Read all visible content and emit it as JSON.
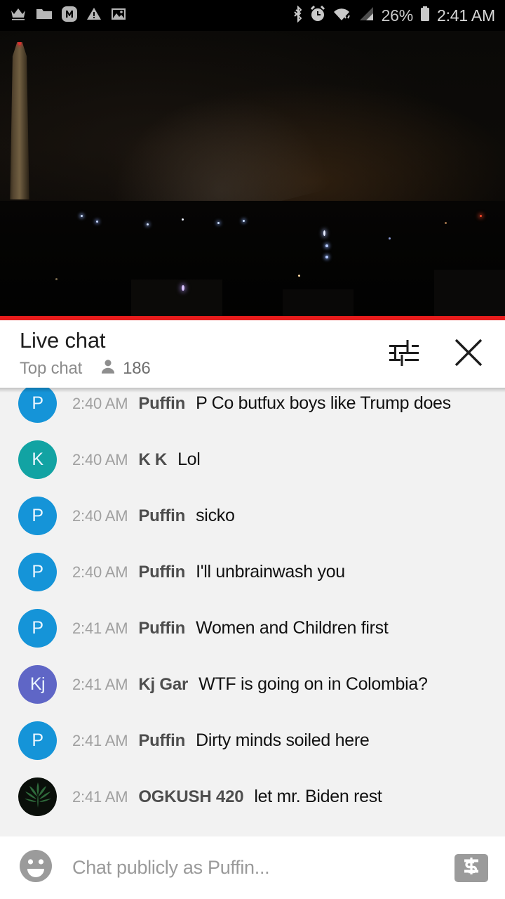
{
  "status_bar": {
    "left_icons": [
      "crown-icon",
      "folder-icon",
      "m-badge-icon",
      "warning-icon",
      "image-icon"
    ],
    "right_icons": [
      "bluetooth-icon",
      "alarm-icon",
      "wifi-icon",
      "cellular-signal-icon",
      "battery-icon"
    ],
    "battery_percent": "26%",
    "time": "2:41 AM"
  },
  "video": {
    "label": "live-video-player",
    "description": "Night skyline of Washington DC with the Washington Monument",
    "progress_percent": 100,
    "progress_color": "#e81c1c"
  },
  "chat_header": {
    "title": "Live chat",
    "mode": "Top chat",
    "viewer_count": "186",
    "viewer_icon": "person-icon",
    "settings_icon": "tune-sliders-icon",
    "close_icon": "close-x-icon"
  },
  "messages": [
    {
      "initials": "P",
      "avatar_color": "#1594d8",
      "time": "2:40 AM",
      "author": "Puffin",
      "text": "P Co butfux boys like Trump does",
      "avatar_type": "initials"
    },
    {
      "initials": "K",
      "avatar_color": "#12a3a3",
      "time": "2:40 AM",
      "author": "K K",
      "text": "Lol",
      "avatar_type": "initials"
    },
    {
      "initials": "P",
      "avatar_color": "#1594d8",
      "time": "2:40 AM",
      "author": "Puffin",
      "text": "sicko",
      "avatar_type": "initials"
    },
    {
      "initials": "P",
      "avatar_color": "#1594d8",
      "time": "2:40 AM",
      "author": "Puffin",
      "text": "I'll unbrainwash you",
      "avatar_type": "initials"
    },
    {
      "initials": "P",
      "avatar_color": "#1594d8",
      "time": "2:41 AM",
      "author": "Puffin",
      "text": "Women and Children first",
      "avatar_type": "initials"
    },
    {
      "initials": "Kj",
      "avatar_color": "#5f66c6",
      "time": "2:41 AM",
      "author": "Kj Gar",
      "text": "WTF is going on in Colombia?",
      "avatar_type": "initials"
    },
    {
      "initials": "P",
      "avatar_color": "#1594d8",
      "time": "2:41 AM",
      "author": "Puffin",
      "text": "Dirty minds soiled here",
      "avatar_type": "initials"
    },
    {
      "initials": "",
      "avatar_color": "#0a0f0a",
      "time": "2:41 AM",
      "author": "OGKUSH 420",
      "text": "let mr. Biden rest",
      "avatar_type": "cannabis-leaf-image"
    }
  ],
  "input_bar": {
    "emoji_icon": "emoji-smiley-icon",
    "placeholder": "Chat publicly as Puffin...",
    "value": "",
    "superchat_icon": "superchat-dollar-icon"
  }
}
